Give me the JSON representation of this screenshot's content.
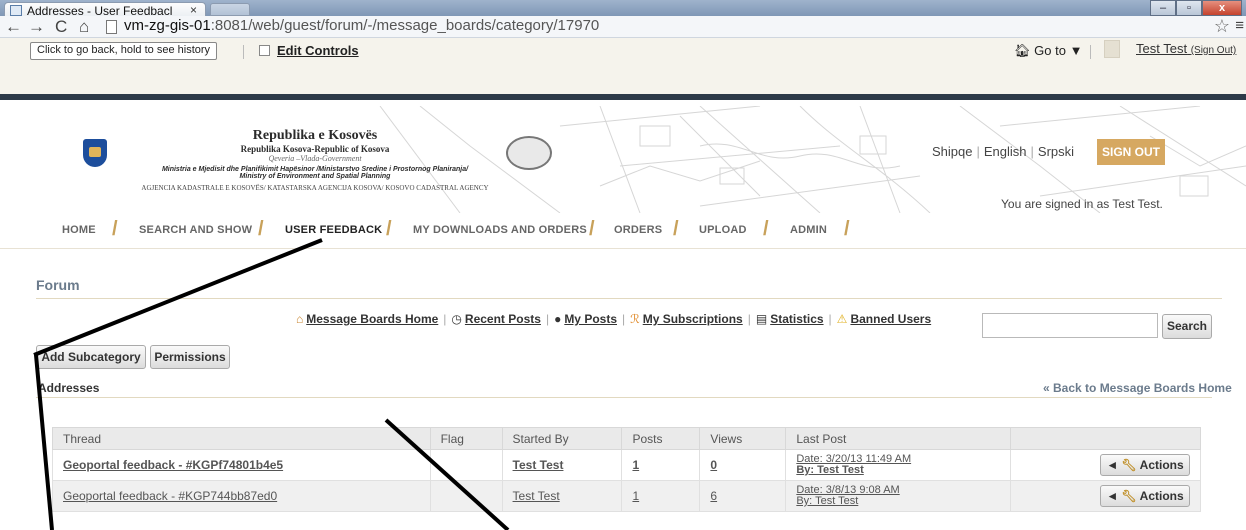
{
  "browser": {
    "tab_title": "Addresses - User Feedbacl",
    "tab_close": "×",
    "url_host": "vm-zg-gis-01",
    "url_path": ":8081/web/guest/forum/-/message_boards/category/17970",
    "back_tooltip": "Click to go back, hold to see history",
    "minimize": "–",
    "maximize": "▫",
    "close": "x"
  },
  "dockbar": {
    "edit_controls": "Edit Controls",
    "goto": "Go to",
    "user_name": "Test Test",
    "sign_out_small": "(Sign Out)"
  },
  "header": {
    "org_line1": "Republika e Kosovës",
    "org_line2": "Republika Kosova-Republic of Kosova",
    "org_line3": "Qeveria –Vlada-Government",
    "org_line4": "Ministria e Mjedisit dhe Planifikimit Hapësinor /Ministarstvo Sredine i Prostornog Planiranja/",
    "org_line5": "Ministry of Environment and Spatial Planning",
    "org_line6": "AGJENCIA KADASTRALE E KOSOVËS/ KATASTARSKA AGENCIJA KOSOVA/ KOSOVO CADASTRAL AGENCY",
    "languages": [
      "Shipqe",
      "English",
      "Srpski"
    ],
    "sign_out": "SIGN OUT",
    "signed_in": "You are signed in as Test Test."
  },
  "main_nav": {
    "items": [
      "HOME",
      "SEARCH AND SHOW",
      "USER FEEDBACK",
      "MY DOWNLOADS AND ORDERS",
      "ORDERS",
      "UPLOAD",
      "ADMIN"
    ],
    "active": "USER FEEDBACK"
  },
  "forum": {
    "title": "Forum",
    "links": [
      "Message Boards Home",
      "Recent Posts",
      "My Posts",
      "My Subscriptions",
      "Statistics",
      "Banned Users"
    ],
    "search_value": "",
    "search_button": "Search",
    "add_subcategory": "Add Subcategory",
    "permissions": "Permissions",
    "category": "Addresses",
    "back_link": "« Back to Message Boards Home"
  },
  "table": {
    "headers": [
      "Thread",
      "Flag",
      "Started By",
      "Posts",
      "Views",
      "Last Post"
    ],
    "rows": [
      {
        "thread": "Geoportal feedback - #KGPf74801b4e5",
        "flag": "",
        "started_by": "Test Test",
        "posts": "1",
        "views": "0",
        "last_date": "Date: 3/20/13 11:49 AM",
        "last_by": "By: Test Test",
        "actions": "Actions"
      },
      {
        "thread": "Geoportal feedback - #KGP744bb87ed0",
        "flag": "",
        "started_by": "Test Test",
        "posts": "1",
        "views": "6",
        "last_date": "Date: 3/8/13 9:08 AM",
        "last_by": "By: Test Test",
        "actions": "Actions"
      }
    ]
  }
}
